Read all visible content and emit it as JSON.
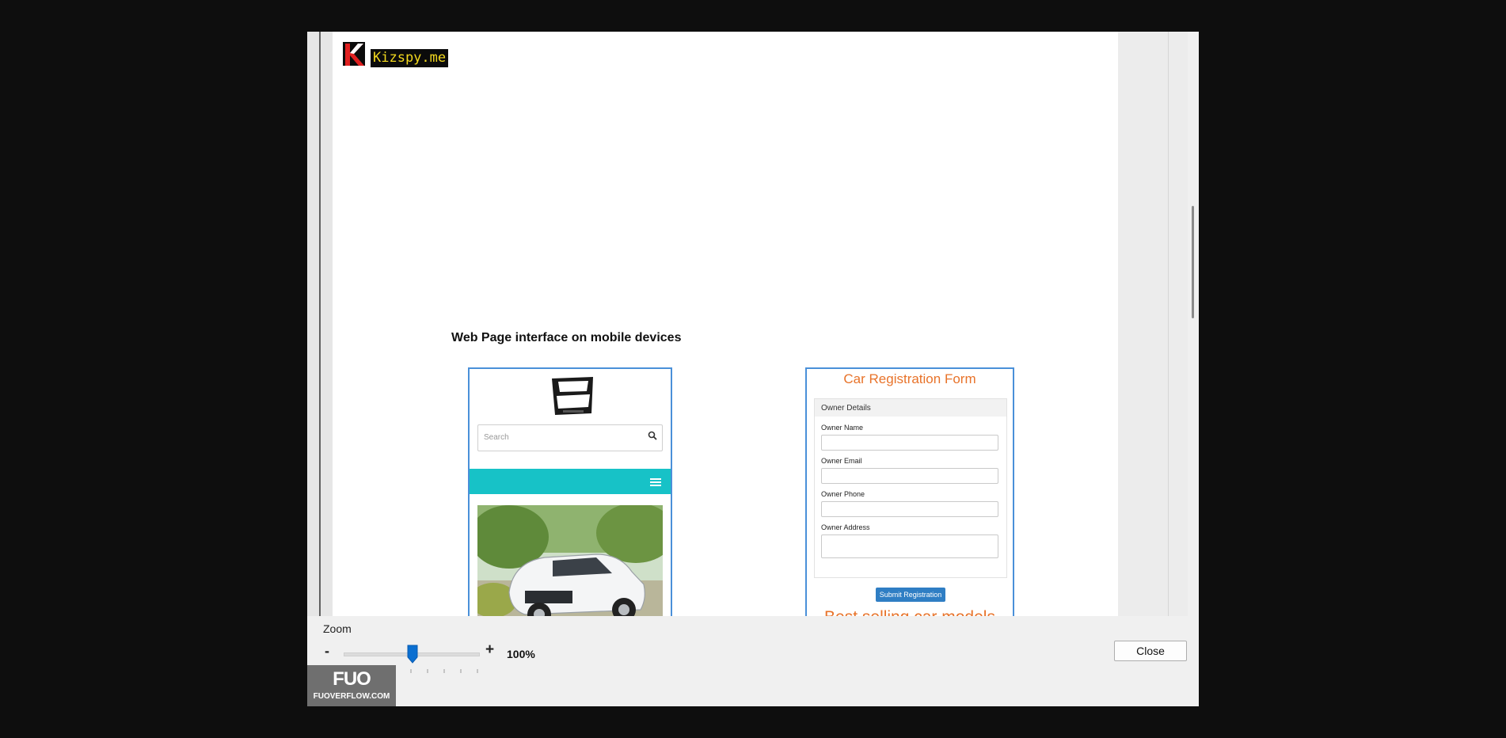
{
  "watermark": {
    "text": "Kizspy.me"
  },
  "document": {
    "section_title": "Web Page interface on mobile devices",
    "mock_site": {
      "logo_text": "XPANDER",
      "search_placeholder": "Search",
      "nav_color": "#17c2c7"
    },
    "registration_form": {
      "title": "Car Registration Form",
      "section_header": "Owner Details",
      "fields": [
        {
          "label": "Owner Name"
        },
        {
          "label": "Owner Email"
        },
        {
          "label": "Owner Phone"
        },
        {
          "label": "Owner Address"
        }
      ],
      "submit_label": "Submit Registration",
      "next_heading": "Best selling car models"
    }
  },
  "controls": {
    "zoom_label": "Zoom",
    "zoom_minus": "-",
    "zoom_plus": "+",
    "zoom_value": "100%",
    "close_label": "Close"
  },
  "badge": {
    "mark": "FUO",
    "site": "FUOVERFLOW.COM"
  },
  "colors": {
    "accent": "#e8732a",
    "frame": "#4a90d9",
    "button": "#2f7ec4",
    "watermark_text": "#f2d81e"
  }
}
